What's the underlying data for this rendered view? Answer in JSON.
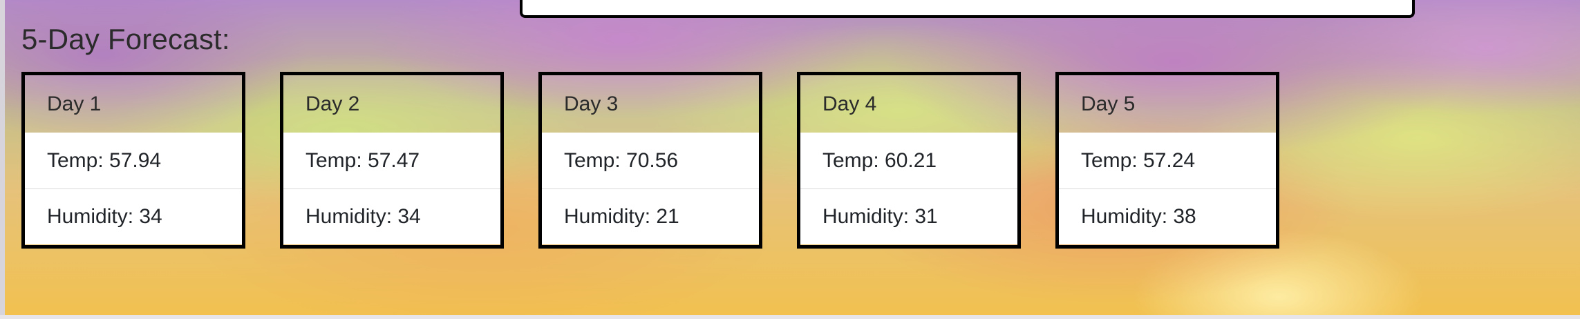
{
  "forecast": {
    "heading": "5-Day Forecast:",
    "days": [
      {
        "label": "Day 1",
        "temp": "Temp: 57.94",
        "humidity": "Humidity: 34"
      },
      {
        "label": "Day 2",
        "temp": "Temp: 57.47",
        "humidity": "Humidity: 34"
      },
      {
        "label": "Day 3",
        "temp": "Temp: 70.56",
        "humidity": "Humidity: 21"
      },
      {
        "label": "Day 4",
        "temp": "Temp: 60.21",
        "humidity": "Humidity: 31"
      },
      {
        "label": "Day 5",
        "temp": "Temp: 57.24",
        "humidity": "Humidity: 38"
      }
    ]
  },
  "colors": {
    "card_border": "#000000",
    "card_body": "#ffffff",
    "text": "#212529"
  }
}
